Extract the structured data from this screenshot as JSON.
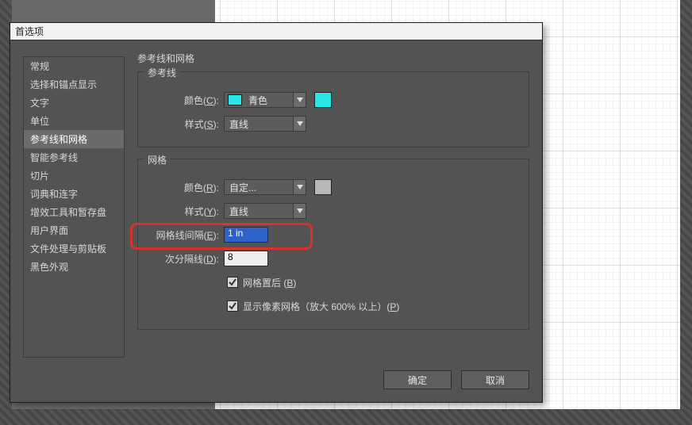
{
  "dialog": {
    "title": "首选项"
  },
  "sidebar": {
    "items": [
      {
        "label": "常规"
      },
      {
        "label": "选择和锚点显示"
      },
      {
        "label": "文字"
      },
      {
        "label": "单位"
      },
      {
        "label": "参考线和网格",
        "selected": true
      },
      {
        "label": "智能参考线"
      },
      {
        "label": "切片"
      },
      {
        "label": "词典和连字"
      },
      {
        "label": "增效工具和暂存盘"
      },
      {
        "label": "用户界面"
      },
      {
        "label": "文件处理与剪贴板"
      },
      {
        "label": "黑色外观"
      }
    ]
  },
  "panel": {
    "title": "参考线和网格",
    "guides": {
      "legend": "参考线",
      "color_label_pre": "颜色(",
      "color_key": "C",
      "color_label_post": "):",
      "color_value": "青色",
      "color_hex": "#28e7e7",
      "style_label_pre": "样式(",
      "style_key": "S",
      "style_label_post": "):",
      "style_value": "直线"
    },
    "grid": {
      "legend": "网格",
      "color_label_pre": "颜色(",
      "color_key": "R",
      "color_label_post": "):",
      "color_value": "自定...",
      "color_hex": "#b7b7b7",
      "style_label_pre": "样式(",
      "style_key": "Y",
      "style_label_post": "):",
      "style_value": "直线",
      "spacing_label_pre": "网格线间隔(",
      "spacing_key": "E",
      "spacing_label_post": "):",
      "spacing_value": "1 in",
      "subdiv_label_pre": "次分隔线(",
      "subdiv_key": "D",
      "subdiv_label_post": "):",
      "subdiv_value": "8",
      "cb_back_pre": "网格置后 (",
      "cb_back_key": "B",
      "cb_back_post": ")",
      "cb_back_checked": true,
      "cb_pixel_pre": "显示像素网格（放大 600% 以上）(",
      "cb_pixel_key": "P",
      "cb_pixel_post": ")",
      "cb_pixel_checked": true
    }
  },
  "footer": {
    "ok": "确定",
    "cancel": "取消"
  }
}
